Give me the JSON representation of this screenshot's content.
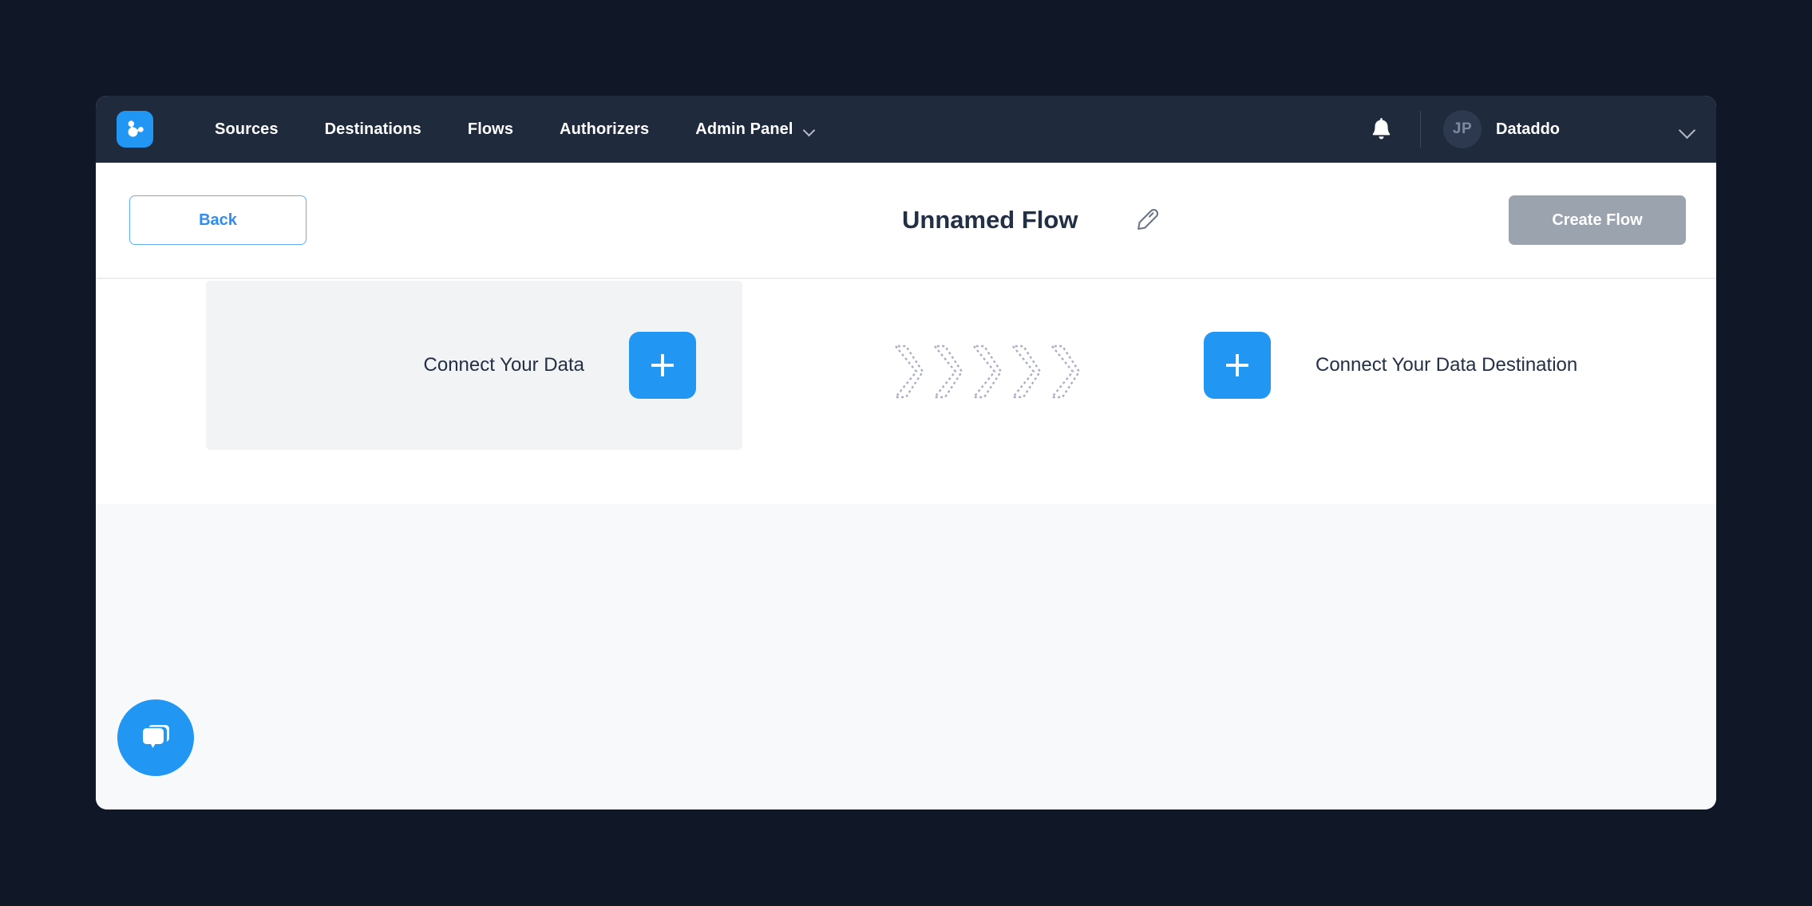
{
  "theme": {
    "page_background": "#101827",
    "navbar_background": "#1f2a3c",
    "accent_blue": "#2196f3",
    "link_blue": "#2f8df0",
    "disabled_gray": "#9ba3af",
    "panel_gray": "#f1f3f5",
    "canvas_gray": "#f8f9fb",
    "text_dark": "#232f45"
  },
  "navbar": {
    "logo_icon": "dataddo-node-graph-logo",
    "links": [
      {
        "label": "Sources",
        "has_chevron": false
      },
      {
        "label": "Destinations",
        "has_chevron": false
      },
      {
        "label": "Flows",
        "has_chevron": false
      },
      {
        "label": "Authorizers",
        "has_chevron": false
      },
      {
        "label": "Admin Panel",
        "has_chevron": true
      }
    ],
    "notifications_icon": "bell-icon",
    "account": {
      "avatar_initials": "JP",
      "name": "Dataddo",
      "chevron_icon": "chevron-down-icon"
    }
  },
  "toolbar": {
    "back_label": "Back",
    "flow_title": "Unnamed Flow",
    "edit_icon": "pencil-icon",
    "create_flow_label": "Create Flow",
    "create_flow_enabled": false
  },
  "flow_builder": {
    "source": {
      "label": "Connect Your Data",
      "add_icon": "plus-icon"
    },
    "connector": {
      "icon": "dashed-chevron-arrow",
      "count": 5
    },
    "destination": {
      "label": "Connect Your Data Destination",
      "add_icon": "plus-icon"
    }
  },
  "chat": {
    "icon": "chat-bubbles-icon"
  }
}
